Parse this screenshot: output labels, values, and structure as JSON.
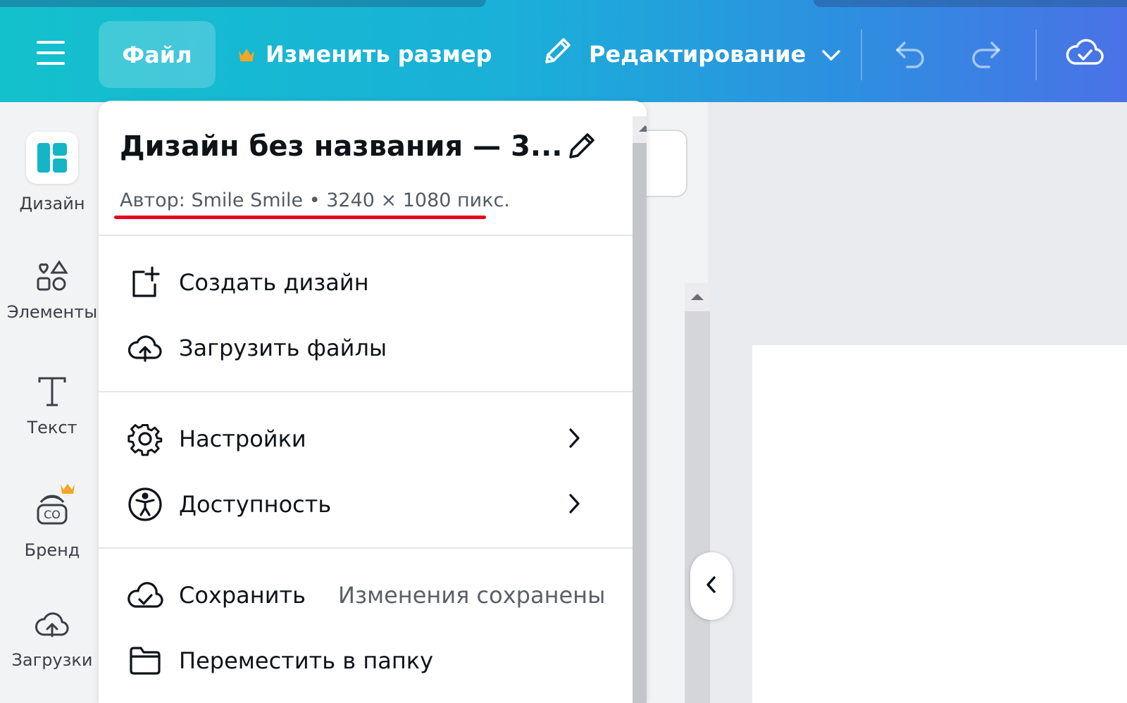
{
  "toolbar": {
    "file_label": "Файл",
    "resize_label": "Изменить размер",
    "editing_label": "Редактирование"
  },
  "sidebar": {
    "items": [
      {
        "label": "Дизайн",
        "icon": "design-icon"
      },
      {
        "label": "Элементы",
        "icon": "elements-icon"
      },
      {
        "label": "Текст",
        "icon": "text-icon"
      },
      {
        "label": "Бренд",
        "icon": "brand-icon"
      },
      {
        "label": "Загрузки",
        "icon": "upload-cloud-icon"
      }
    ]
  },
  "panel": {
    "title": "Дизайн без названия — 3...",
    "meta": "Автор: Smile Smile • 3240 × 1080 пикс.",
    "menu": {
      "create": "Создать дизайн",
      "upload": "Загрузить файлы",
      "settings": "Настройки",
      "accessibility": "Доступность",
      "save": "Сохранить",
      "save_status": "Изменения сохранены",
      "move": "Переместить в папку"
    }
  },
  "colors": {
    "accent": "#13c1cc",
    "gradient_end": "#4a72e6",
    "crown": "#f5a623",
    "highlight_underline": "#e8001c"
  }
}
